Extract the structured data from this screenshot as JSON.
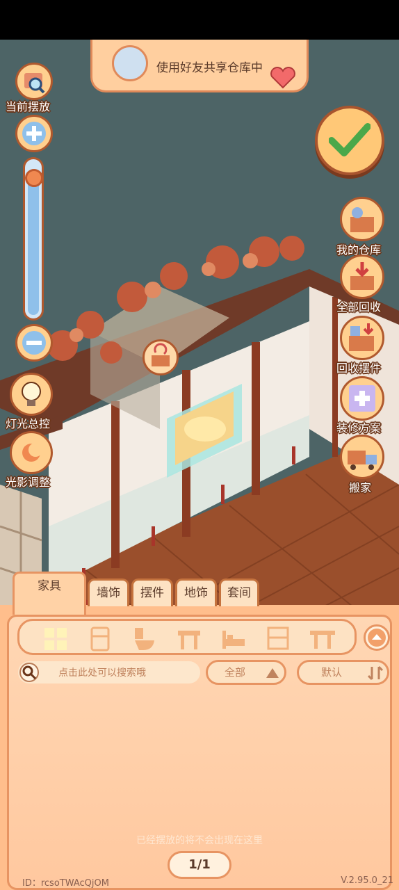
{
  "banner": {
    "text": "使用好友共享仓库中"
  },
  "left_controls": {
    "current_place_label": "当前摆放",
    "light_label": "灯光总控",
    "shadow_label": "光影调整"
  },
  "zoom_level": 0.95,
  "right_menu": {
    "warehouse_label": "我的仓库",
    "recycle_all_label": "全部回收",
    "recycle_decor_label": "回收摆件",
    "plans_label": "装修方案",
    "move_label": "搬家"
  },
  "tabs": [
    "家具",
    "墙饰",
    "摆件",
    "地饰",
    "套间"
  ],
  "active_tab": 0,
  "categories": [
    "all-grid-icon",
    "fridge-icon",
    "toilet-icon",
    "table-icon",
    "bed-icon",
    "cabinet-icon",
    "bench-icon"
  ],
  "search": {
    "placeholder": "点击此处可以搜索哦"
  },
  "filter": {
    "label": "全部"
  },
  "sort": {
    "label": "默认"
  },
  "empty_message": "已经摆放的将不会出现在这里",
  "page": "1/1",
  "footer": {
    "id": "ID：rcsoTWAcQjOM",
    "version": "V.2.95.0_21"
  },
  "colors": {
    "accent": "#e79462",
    "panel": "#ffbe8c",
    "border_dark": "#b0592e"
  }
}
